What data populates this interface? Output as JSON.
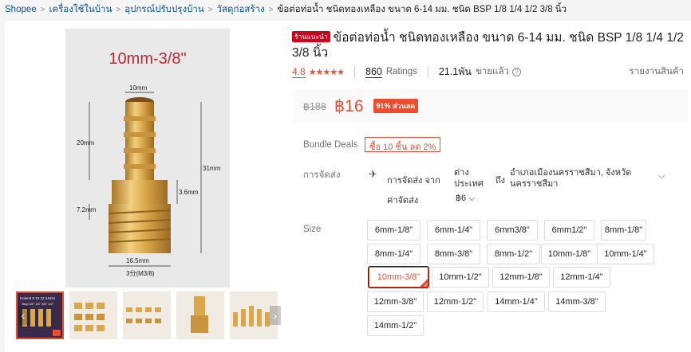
{
  "breadcrumb": [
    "Shopee",
    "เครื่องใช้ในบ้าน",
    "อุปกรณ์ปรับปรุงบ้าน",
    "วัสดุก่อสร้าง",
    "ข้อต่อท่อน้ำ ชนิดทองเหลือง ขนาด 6-14 มม. ชนิด BSP 1/8 1/4 1/2 3/8 นิ้ว"
  ],
  "product": {
    "badge": "ร้านแนะนำ",
    "title": "ข้อต่อท่อน้ำ ชนิดทองเหลือง ขนาด 6-14 มม. ชนิด BSP 1/8 1/4 1/2 3/8 นิ้ว",
    "rating": "4.8",
    "stars": "★★★★★",
    "ratings_count": "860",
    "ratings_label": "Ratings",
    "sold": "21.1พัน",
    "sold_label": "ขายแล้ว",
    "report": "รายงานสินค้า",
    "old_price": "฿188",
    "price": "฿16",
    "discount": "91% ส่วนลด"
  },
  "image": {
    "caption": "10mm-3/8\"",
    "dim_top": "10mm",
    "dim_20": "20mm",
    "dim_31": "31mm",
    "dim_36": "3.6mm",
    "dim_72": "7.2mm",
    "dim_165": "16.5mm",
    "dim_thread": "3分(M3/8)",
    "thumb_text": "Hose:6 8 10 12 14mm",
    "thumb_text2": "Bsp:1/8\" 1/4\" 3/8\" 1/2\""
  },
  "labels": {
    "bundle": "Bundle Deals",
    "shipping": "การจัดส่ง",
    "size": "Size"
  },
  "bundle_tag": "ซื้อ 10 ชิ้น ลด 2%",
  "shipping": {
    "from_label": "การจัดส่ง จาก",
    "from_line1": "ต่าง",
    "from_line2": "ประเทศ",
    "to_label": "ถึง",
    "to_line1": "อำเภอเมืองนครราชสีมา, จังหวัด",
    "to_line2": "นครราชสีมา",
    "fee_label": "ค่าจัดส่ง",
    "fee_value": "฿6"
  },
  "sizes": [
    "6mm-1/8\"",
    "6mm-1/4\"",
    "6mm3/8\"",
    "6mm1/2\"",
    "8mm-1/8\"",
    "8mm-1/4\"",
    "8mm-3/8\"",
    "8mm-1/2\"",
    "10mm-1/8\"",
    "10mm-1/4\"",
    "10mm-3/8\"",
    "10mm-1/2\"",
    "12mm-1/8\"",
    "12mm-1/4\"",
    "12mm-3/8\"",
    "12mm-1/2\"",
    "14mm-1/4\"",
    "14mm-3/8\"",
    "14mm-1/2\""
  ],
  "selected_size": "10mm-3/8\"",
  "colors": {
    "accent": "#ee4d2d",
    "link": "#0055aa",
    "brass": "#d9a84a"
  }
}
